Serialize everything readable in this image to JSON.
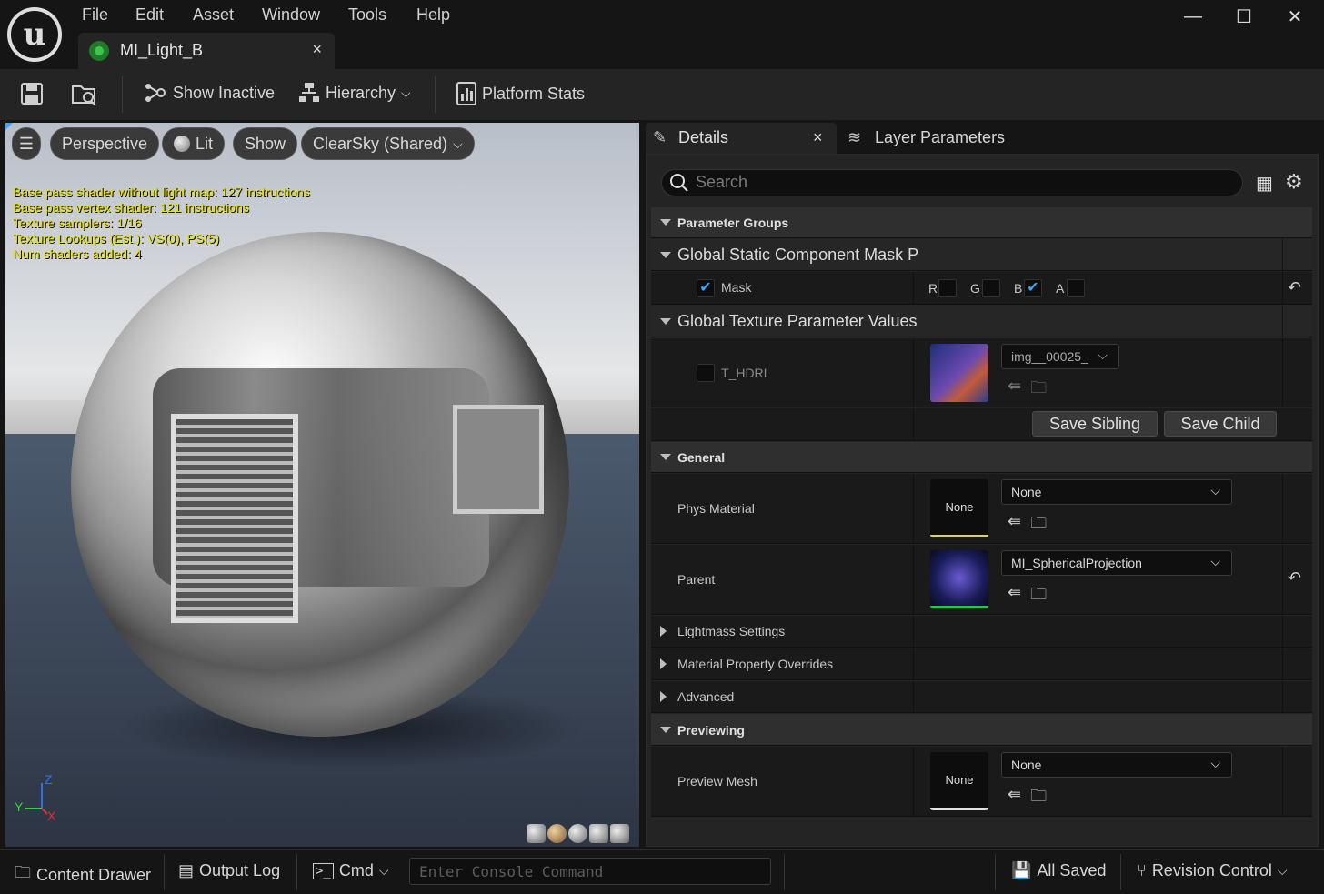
{
  "menu": [
    "File",
    "Edit",
    "Asset",
    "Window",
    "Tools",
    "Help"
  ],
  "window_controls": {
    "minimize": "—",
    "maximize": "☐",
    "close": "✕"
  },
  "document_tab": {
    "title": "MI_Light_B",
    "close": "×"
  },
  "toolbar": {
    "show_inactive": "Show Inactive",
    "hierarchy": "Hierarchy",
    "platform_stats": "Platform Stats"
  },
  "viewport": {
    "perspective": "Perspective",
    "lit": "Lit",
    "show": "Show",
    "environment": "ClearSky (Shared)",
    "stats": [
      "Base pass shader without light map: 127 instructions",
      "Base pass vertex shader: 121 instructions",
      "Texture samplers: 1/16",
      "Texture Lookups (Est.): VS(0), PS(5)",
      "Num shaders added: 4"
    ],
    "axis": {
      "z": "Z",
      "y": "Y",
      "x": "X"
    }
  },
  "panel_tabs": {
    "details": "Details",
    "details_close": "×",
    "layer_parameters": "Layer Parameters"
  },
  "details": {
    "search_placeholder": "Search",
    "parameter_groups": "Parameter Groups",
    "global_static_mask": "Global Static Component Mask P",
    "mask_label": "Mask",
    "mask_channels": {
      "r": "R",
      "g": "G",
      "b": "B",
      "a": "A"
    },
    "global_texture": "Global Texture Parameter Values",
    "t_hdri": "T_HDRI",
    "t_hdri_value": "img__00025_",
    "save_sibling": "Save Sibling",
    "save_child": "Save Child",
    "general": "General",
    "phys_material": "Phys Material",
    "phys_material_thumb": "None",
    "phys_material_value": "None",
    "parent": "Parent",
    "parent_value": "MI_SphericalProjection",
    "lightmass": "Lightmass Settings",
    "material_overrides": "Material Property Overrides",
    "advanced": "Advanced",
    "previewing": "Previewing",
    "preview_mesh": "Preview Mesh",
    "preview_mesh_thumb": "None",
    "preview_mesh_value": "None"
  },
  "bottom_bar": {
    "content_drawer": "Content Drawer",
    "output_log": "Output Log",
    "cmd": "Cmd",
    "console_placeholder": "Enter Console Command",
    "all_saved": "All Saved",
    "revision_control": "Revision Control"
  },
  "colors": {
    "accent_blue": "#3ea0ff",
    "stats_yellow": "#e8e200",
    "parent_green": "#2ec44a"
  }
}
